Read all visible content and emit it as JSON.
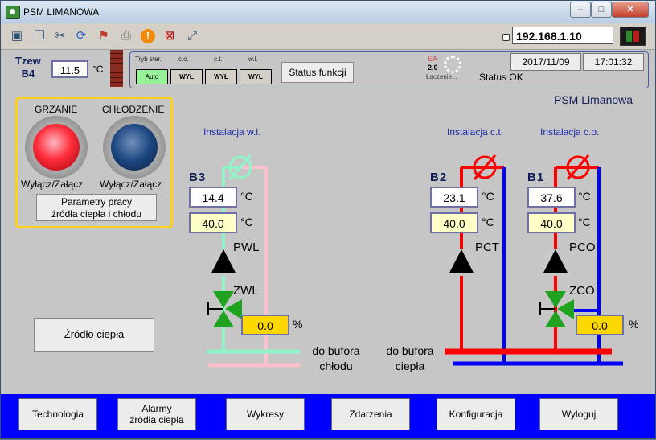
{
  "window": {
    "title": "PSM LIMANOWA",
    "minimize": "–",
    "maximize": "□",
    "close": "✕"
  },
  "toolbar": {
    "icons": [
      "monitor-icon",
      "windows-icon",
      "tools-icon",
      "refresh-icon",
      "xp-icon",
      "printer-icon",
      "alert-icon",
      "network-error-icon",
      "fullscreen-icon"
    ],
    "ip": "192.168.1.10"
  },
  "status": {
    "tzew_label": "Tzew",
    "tzew_sensor": "B4",
    "tzew_value": "11.5",
    "tzew_unit": "°C",
    "mode_header": "Tryb ster.",
    "co_header": "c.o.",
    "ct_header": "c.t.",
    "wl_header": "w.l.",
    "mode_value": "Auto",
    "co_value": "WYŁ",
    "ct_value": "WYŁ",
    "wl_value": "WYŁ",
    "status_functions_button": "Status funkcji",
    "ea_label": "EA",
    "ea_version": "2.0",
    "connecting": "Łączenie...",
    "date": "2017/11/09",
    "time": "17:01:32",
    "status_text": "Status OK"
  },
  "main": {
    "site_title": "PSM Limanowa",
    "heating_label": "GRZANIE",
    "cooling_label": "CHŁODZENIE",
    "heating_toggle": "Wyłącz/Załącz",
    "cooling_toggle": "Wyłącz/Załącz",
    "params_button_line1": "Parametry pracy",
    "params_button_line2": "źródła ciepła i chłodu",
    "source_button": "Źródło ciepła"
  },
  "installations": {
    "wl": {
      "title": "Instalacja w.l.",
      "sensor": "B3",
      "current": "14.4",
      "setpoint": "40.0",
      "unit": "°C",
      "pump": "PWL",
      "valve": "ZWL",
      "valve_pct": "0.0",
      "pct_unit": "%"
    },
    "ct": {
      "title": "Instalacja c.t.",
      "sensor": "B2",
      "current": "23.1",
      "setpoint": "40.0",
      "unit": "°C",
      "pump": "PCT"
    },
    "co": {
      "title": "Instalacja c.o.",
      "sensor": "B1",
      "current": "37.6",
      "setpoint": "40.0",
      "unit": "°C",
      "pump": "PCO",
      "valve": "ZCO",
      "valve_pct": "0.0",
      "pct_unit": "%"
    }
  },
  "buffers": {
    "cold_line1": "do bufora",
    "cold_line2": "chłodu",
    "heat_line1": "do bufora",
    "heat_line2": "ciepła"
  },
  "nav": {
    "technology": "Technologia",
    "alarms_line1": "Alarmy",
    "alarms_line2": "źródła ciepła",
    "charts": "Wykresy",
    "events": "Zdarzenia",
    "config": "Konfiguracja",
    "logout": "Wyloguj"
  },
  "colors": {
    "heating_lamp": "#ff2e3c",
    "cooling_lamp": "#1c4680",
    "hot_pipe": "#ff0000",
    "return_pipe": "#0000ff",
    "wl_supply": "#8ff5c8",
    "wl_return": "#ffc0cb",
    "bottom_bar": "#0000ff",
    "valve": "#1fa21f"
  }
}
